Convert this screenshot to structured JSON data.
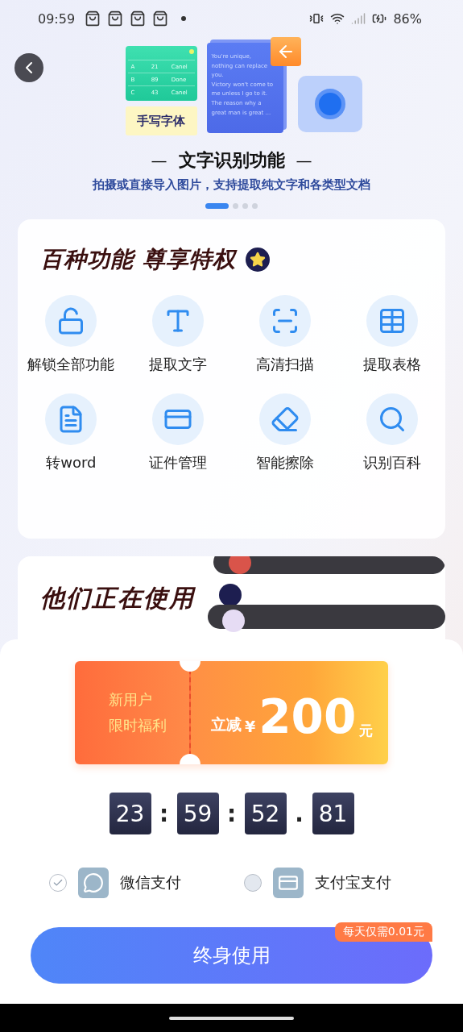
{
  "status_bar": {
    "time": "09:59",
    "battery": "86%"
  },
  "banner": {
    "illustration": {
      "table_rows": [
        [
          "A",
          "21",
          "Canel"
        ],
        [
          "B",
          "89",
          "Done"
        ],
        [
          "C",
          "43",
          "Canel"
        ]
      ],
      "handwriting": "手写字体",
      "doc_lines": [
        "You're unique,",
        "nothing can replace",
        "you.",
        "Victory won't come to",
        "me unless I go to it.",
        "The reason why a",
        "great man is great ..."
      ]
    },
    "title_dash_left": "—",
    "title": "文字识别功能",
    "title_dash_right": "—",
    "subtitle": "拍摄或直接导入图片，支持提取纯文字和各类型文档",
    "pages": [
      {
        "selected": true
      },
      {
        "selected": false
      },
      {
        "selected": false
      },
      {
        "selected": false
      }
    ]
  },
  "features": {
    "title": "百种功能 尊享特权",
    "items": [
      {
        "kind": "unlock",
        "label": "解锁全部功能"
      },
      {
        "kind": "text",
        "label": "提取文字"
      },
      {
        "kind": "scan",
        "label": "高清扫描"
      },
      {
        "kind": "table",
        "label": "提取表格"
      },
      {
        "kind": "word",
        "label": "转word"
      },
      {
        "kind": "card",
        "label": "证件管理"
      },
      {
        "kind": "erase",
        "label": "智能擦除"
      },
      {
        "kind": "search",
        "label": "识别百科"
      }
    ]
  },
  "users": {
    "title": "他们正在使用"
  },
  "offer": {
    "coupon": {
      "left_lines": [
        "新用户",
        "限时福利"
      ],
      "prefix": "立减",
      "currency": "¥",
      "amount": "200",
      "unit": "元"
    },
    "countdown": {
      "parts": [
        "23",
        "59",
        "52",
        "81"
      ],
      "separators": [
        ":",
        ":",
        "."
      ]
    },
    "payments": [
      {
        "kind": "wechat",
        "label": "微信支付",
        "selected": true
      },
      {
        "kind": "alipay",
        "label": "支付宝支付",
        "selected": false
      }
    ],
    "button": {
      "label": "终身使用",
      "badge": "每天仅需0.01元"
    }
  }
}
